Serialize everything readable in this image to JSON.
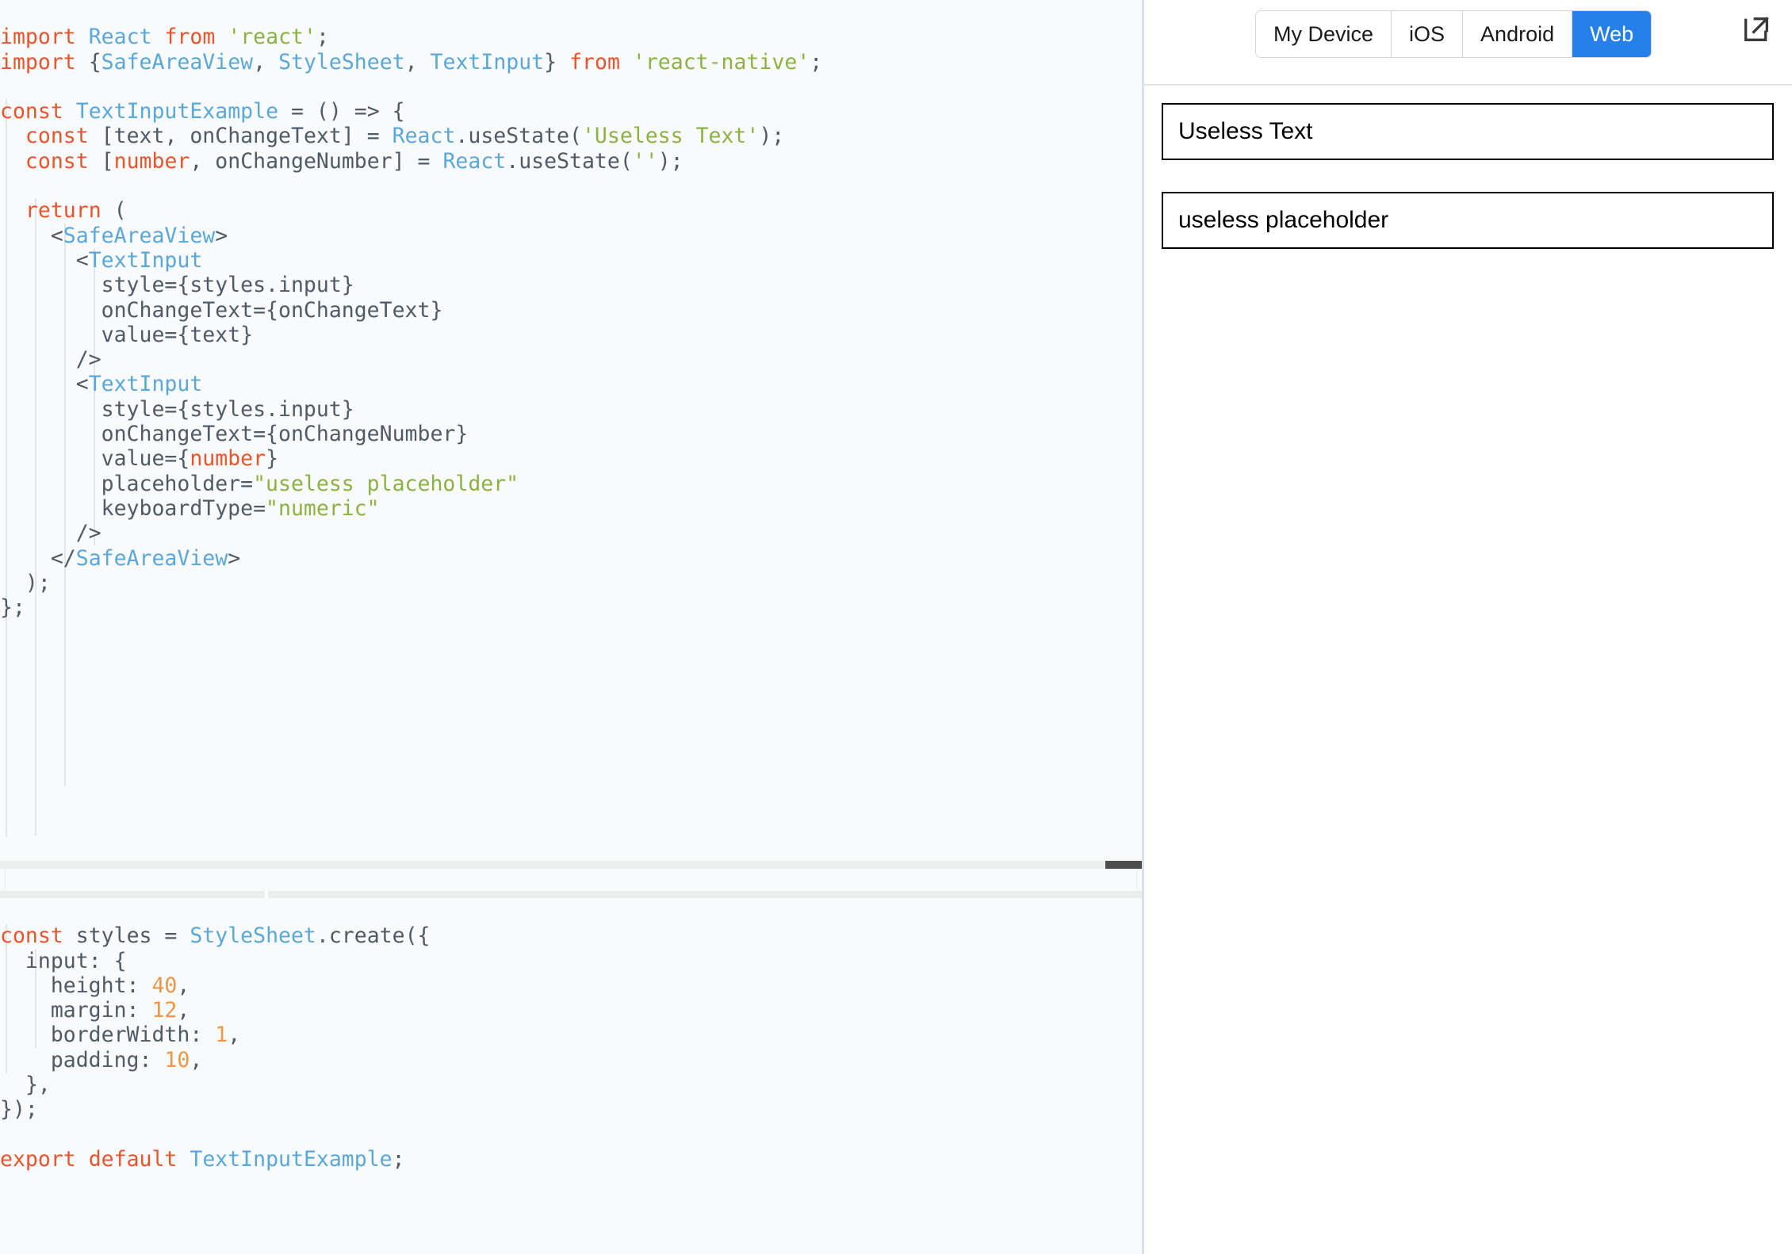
{
  "editor": {
    "language": "jsx",
    "background": "#f9fafc",
    "colors": {
      "keyword": "#e8552c",
      "identifier": "#5aa8d9",
      "string": "#8cb342",
      "number": "#ec9749",
      "plain": "#4f5b66",
      "indent_guide": "#e2e6ea"
    },
    "top_block_lines": [
      "import React from 'react';",
      "import {SafeAreaView, StyleSheet, TextInput} from 'react-native';",
      "",
      "const TextInputExample = () => {",
      "  const [text, onChangeText] = React.useState('Useless Text');",
      "  const [number, onChangeNumber] = React.useState('');",
      "",
      "  return (",
      "    <SafeAreaView>",
      "      <TextInput",
      "        style={styles.input}",
      "        onChangeText={onChangeText}",
      "        value={text}",
      "      />",
      "      <TextInput",
      "        style={styles.input}",
      "        onChangeText={onChangeNumber}",
      "        value={number}",
      "        placeholder=\"useless placeholder\"",
      "        keyboardType=\"numeric\"",
      "      />",
      "    </SafeAreaView>",
      "  );",
      "};"
    ],
    "bottom_block_lines": [
      "const styles = StyleSheet.create({",
      "  input: {",
      "    height: 40,",
      "    margin: 12,",
      "    borderWidth: 1,",
      "    padding: 10,",
      "  },",
      "});",
      "",
      "export default TextInputExample;"
    ],
    "scrollbar": {
      "orientation": "horizontal",
      "thumb_color": "#4d4d4d",
      "track_color": "#eceded",
      "thumb_position": "right"
    }
  },
  "preview": {
    "platform_tabs": [
      {
        "label": "My Device",
        "active": false
      },
      {
        "label": "iOS",
        "active": false
      },
      {
        "label": "Android",
        "active": false
      },
      {
        "label": "Web",
        "active": true
      }
    ],
    "active_tab": "Web",
    "accent_color": "#2680eb",
    "open_external_icon": "external-link-icon",
    "inputs": [
      {
        "value": "Useless Text",
        "placeholder": "",
        "keyboard_type": "default"
      },
      {
        "value": "",
        "placeholder": "useless placeholder",
        "keyboard_type": "numeric"
      }
    ]
  }
}
